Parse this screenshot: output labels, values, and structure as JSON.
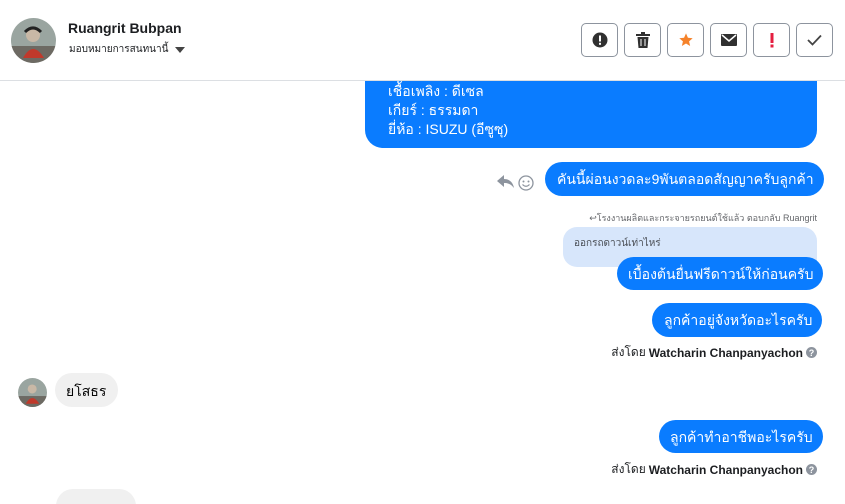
{
  "header": {
    "contact_name": "Ruangrit Bubpan",
    "assign_label": "มอบหมายการสนทนานี้",
    "toolbar": [
      {
        "name": "spam-button",
        "icon": "alert-circle-icon",
        "glyph": "!"
      },
      {
        "name": "delete-button",
        "icon": "trash-icon",
        "glyph": "🗑"
      },
      {
        "name": "star-button",
        "icon": "star-icon",
        "glyph": "★"
      },
      {
        "name": "mark-unread-button",
        "icon": "envelope-icon",
        "glyph": "✉"
      },
      {
        "name": "follow-up-button",
        "icon": "exclamation-icon",
        "glyph": "!"
      },
      {
        "name": "done-button",
        "icon": "check-icon",
        "glyph": "✓"
      }
    ]
  },
  "messages": {
    "spec_lines": [
      "เชื้อเพลิง : ดีเซล",
      "เกียร์ : ธรรมดา",
      "ยี่ห้อ : ISUZU (อีซูซุ)"
    ],
    "out1": "คันนี้ผ่อนงวดละ9พันตลอดสัญญาครับลูกค้า",
    "reply_header": "โรงงานผลิตและกระจายรถยนต์ใช้แล้ว ตอบกลับ Ruangrit",
    "quoted": "ออกรถดาวน์เท่าไหร่",
    "out2": "เบื้องต้นยื่นฟรีดาวน์ให้ก่อนครับ",
    "out3": "ลูกค้าอยู่จังหวัดอะไรครับ",
    "sent_by_prefix": "ส่งโดย",
    "sender": "Watcharin Chanpanyachon",
    "in1": "ยโสธร",
    "out4": "ลูกค้าทำอาชีพอะไรครับ"
  },
  "colors": {
    "outgoing_bubble": "#0a7cff",
    "incoming_bubble": "#f0f0f0",
    "quote_bubble": "#d7e6fb",
    "star": "#f5822a",
    "follow_up": "#e41e3f"
  }
}
